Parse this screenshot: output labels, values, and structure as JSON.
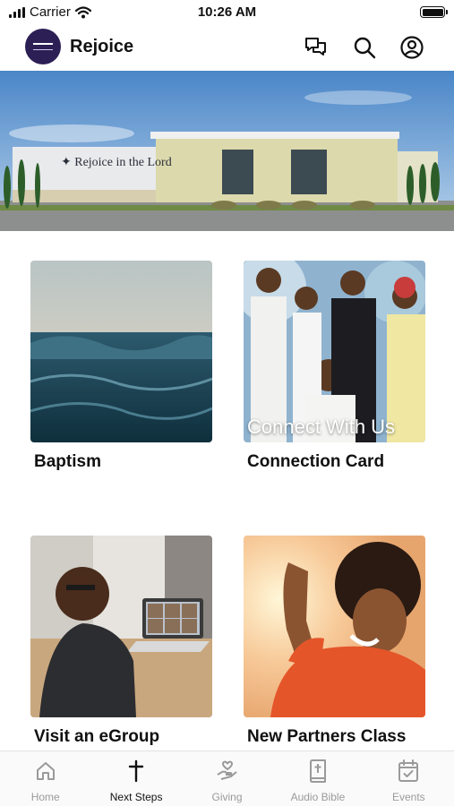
{
  "status_bar": {
    "carrier": "Carrier",
    "time": "10:26 AM"
  },
  "header": {
    "title": "Rejoice"
  },
  "banner": {
    "sign_text": "✦ Rejoice in the Lord"
  },
  "tiles": [
    {
      "label": "Baptism",
      "overlay": ""
    },
    {
      "label": "Connection Card",
      "overlay": "Connect With Us"
    },
    {
      "label": "Visit an eGroup",
      "overlay": ""
    },
    {
      "label": "New Partners Class",
      "overlay": ""
    }
  ],
  "tab_bar": {
    "items": [
      {
        "label": "Home",
        "icon": "home-icon",
        "active": false
      },
      {
        "label": "Next Steps",
        "icon": "cross-icon",
        "active": true
      },
      {
        "label": "Giving",
        "icon": "giving-hand-icon",
        "active": false
      },
      {
        "label": "Audio Bible",
        "icon": "bible-icon",
        "active": false
      },
      {
        "label": "Events",
        "icon": "calendar-check-icon",
        "active": false
      }
    ]
  },
  "colors": {
    "logo_bg": "#2c1f55",
    "active_tab": "#111111",
    "inactive_tab": "#9a9a9a"
  }
}
